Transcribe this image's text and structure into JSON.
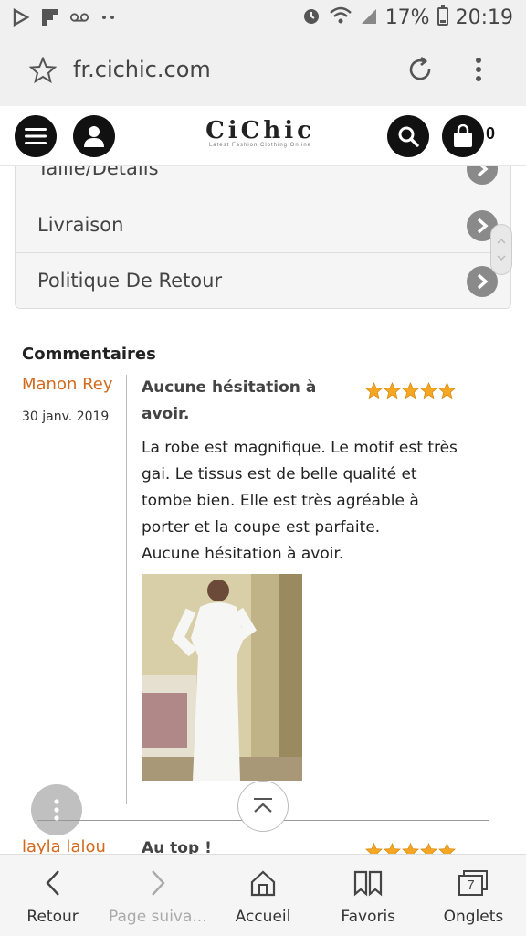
{
  "status_bar": {
    "battery": "17%",
    "time": "20:19",
    "icons": [
      "play-store-icon",
      "flipboard-icon",
      "voicemail-icon",
      "dots-icon",
      "alarm-icon",
      "wifi-icon",
      "signal-icon",
      "battery-icon"
    ]
  },
  "browser": {
    "url": "fr.cichic.com"
  },
  "site_header": {
    "logo": "CiChic",
    "logo_tagline": "Latest Fashion Clothing Online",
    "cart_count": "0"
  },
  "accordion": {
    "items": [
      {
        "label": "Taille/Détails"
      },
      {
        "label": "Livraison"
      },
      {
        "label": "Politique De Retour"
      }
    ]
  },
  "comments": {
    "title": "Commentaires",
    "reviews": [
      {
        "author": "Manon Rey",
        "date": "30 janv. 2019",
        "title": "Aucune hésitation à avoir.",
        "rating": 5,
        "body_lines": [
          "La robe est magnifique. Le motif est très",
          "gai. Le tissus est de belle qualité et",
          "tombe bien. Elle est très agréable à",
          "porter et la coupe est parfaite.",
          "Aucune hésitation à avoir."
        ]
      },
      {
        "author": "layla lalou",
        "title": "Au top !",
        "rating": 5
      }
    ]
  },
  "bottom_nav": {
    "items": [
      {
        "label": "Retour",
        "icon": "back-icon"
      },
      {
        "label": "Page suiva...",
        "icon": "forward-icon"
      },
      {
        "label": "Accueil",
        "icon": "home-icon"
      },
      {
        "label": "Favoris",
        "icon": "bookmarks-icon"
      },
      {
        "label": "Onglets",
        "icon": "tabs-icon",
        "count": "7"
      }
    ]
  },
  "colors": {
    "author": "#d2691e",
    "star": "#f5a623",
    "accent_dark": "#111111"
  }
}
